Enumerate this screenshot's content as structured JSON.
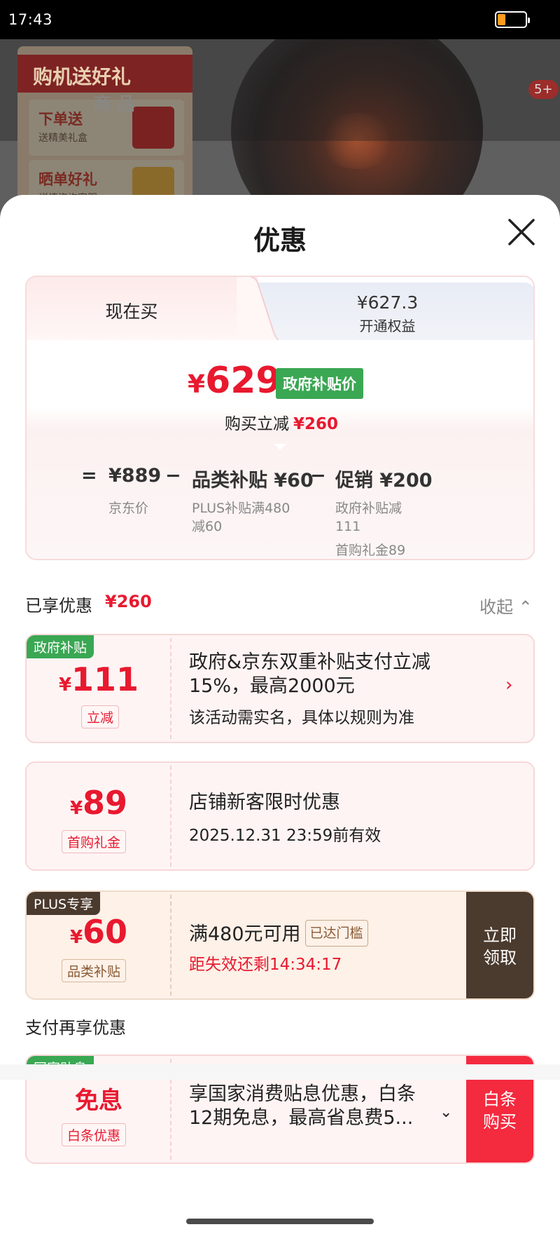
{
  "status_bar": {
    "time": "17:43",
    "battery_level_pct": 30
  },
  "background": {
    "promo_title": "购机送好礼",
    "promo_card1_title": "下单送",
    "promo_card1_sub": "送精美礼盒",
    "promo_card2_title": "晒单好礼",
    "promo_card2_sub": "详情咨询客服",
    "tab_text": "商品",
    "cart_badge": "5+"
  },
  "sheet": {
    "title": "优惠"
  },
  "price_tabs": {
    "now_label": "现在买",
    "member_price": "¥627.3",
    "member_label": "开通权益"
  },
  "price": {
    "currency": "¥",
    "value": "629",
    "badge": "政府补贴价",
    "reduce_label": "购买立减",
    "reduce_amount": "¥260"
  },
  "breakdown": {
    "equals": "=",
    "jd_price": "¥889",
    "jd_label": "京东价",
    "minus1": "−",
    "category_label": "品类补贴 ¥60",
    "category_sub1": "PLUS补贴满480",
    "category_sub2": "减60",
    "minus2": "−",
    "promo_label": "促销 ¥200",
    "promo_sub1": "政府补贴减",
    "promo_sub2": "111",
    "promo_sub3": "首购礼金89"
  },
  "enjoyed": {
    "label": "已享优惠",
    "amount": "¥260",
    "collapse_label": "收起 ⌃"
  },
  "coupons": [
    {
      "tag": "政府补贴",
      "currency": "¥",
      "amount": "111",
      "pill": "立减",
      "line1": "政府&京东双重补贴支付立减",
      "line2": "15%，最高2000元",
      "sub": "该活动需实名，具体以规则为准",
      "chevron": "›"
    },
    {
      "currency": "¥",
      "amount": "89",
      "pill": "首购礼金",
      "line1": "店铺新客限时优惠",
      "sub": "2025.12.31 23:59前有效"
    },
    {
      "tag": "PLUS专享",
      "currency": "¥",
      "amount": "60",
      "pill": "品类补贴",
      "line1": "满480元可用",
      "reached": "已达门槛",
      "countdown": "距失效还剩14:34:17",
      "button_line1": "立即",
      "button_line2": "领取"
    }
  ],
  "pay": {
    "section_title": "支付再享优惠",
    "tag": "国家贴息",
    "headline": "免息",
    "pill": "白条优惠",
    "line1": "享国家消费贴息优惠，白条",
    "line2": "12期免息，最高省息费5...",
    "expand": "⌄",
    "button_line1": "白条",
    "button_line2": "购买"
  },
  "colors": {
    "accent_red": "#e8192f",
    "gov_green": "#3aa753",
    "plus_brown": "#4b3a2e",
    "baitiao_red": "#f42a3f"
  }
}
